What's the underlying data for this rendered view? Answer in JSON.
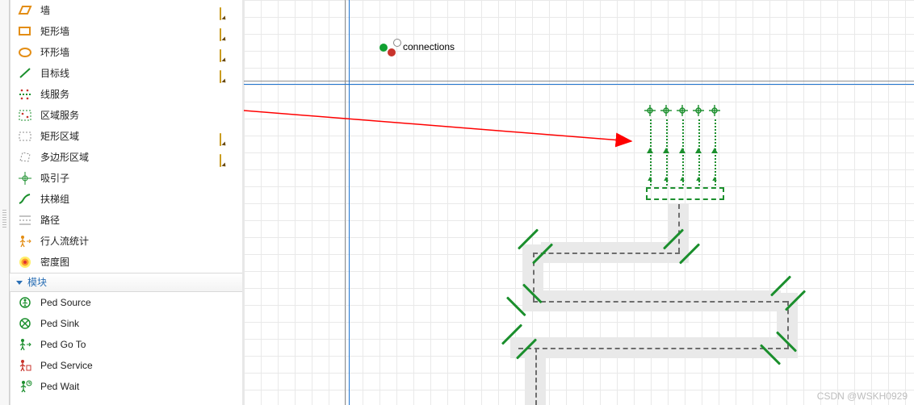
{
  "palette": {
    "space_items": [
      {
        "key": "wall",
        "label": "墙",
        "edit": true
      },
      {
        "key": "rectwall",
        "label": "矩形墙",
        "edit": true
      },
      {
        "key": "ringwall",
        "label": "环形墙",
        "edit": true
      },
      {
        "key": "targetline",
        "label": "目标线",
        "edit": true
      },
      {
        "key": "lineservice",
        "label": "线服务",
        "edit": false
      },
      {
        "key": "areaservice",
        "label": "区域服务",
        "edit": false
      },
      {
        "key": "rectarea",
        "label": "矩形区域",
        "edit": true
      },
      {
        "key": "polyarea",
        "label": "多边形区域",
        "edit": true
      },
      {
        "key": "attractor",
        "label": "吸引子",
        "edit": false
      },
      {
        "key": "escalator",
        "label": "扶梯组",
        "edit": false
      },
      {
        "key": "path",
        "label": "路径",
        "edit": false
      },
      {
        "key": "flowstat",
        "label": "行人流统计",
        "edit": false
      },
      {
        "key": "density",
        "label": "密度图",
        "edit": false
      }
    ],
    "blocks_header": "模块",
    "block_items": [
      {
        "key": "pedsource",
        "label": "Ped Source"
      },
      {
        "key": "pedsink",
        "label": "Ped Sink"
      },
      {
        "key": "pedgoto",
        "label": "Ped Go To"
      },
      {
        "key": "pedservice",
        "label": "Ped Service"
      },
      {
        "key": "pedwait",
        "label": "Ped Wait"
      }
    ]
  },
  "canvas": {
    "connections_label": "connections"
  },
  "colors": {
    "green": "#1b8f2d",
    "orange": "#e38d14",
    "blue": "#1e74d2"
  },
  "watermark": "CSDN @WSKH0929"
}
